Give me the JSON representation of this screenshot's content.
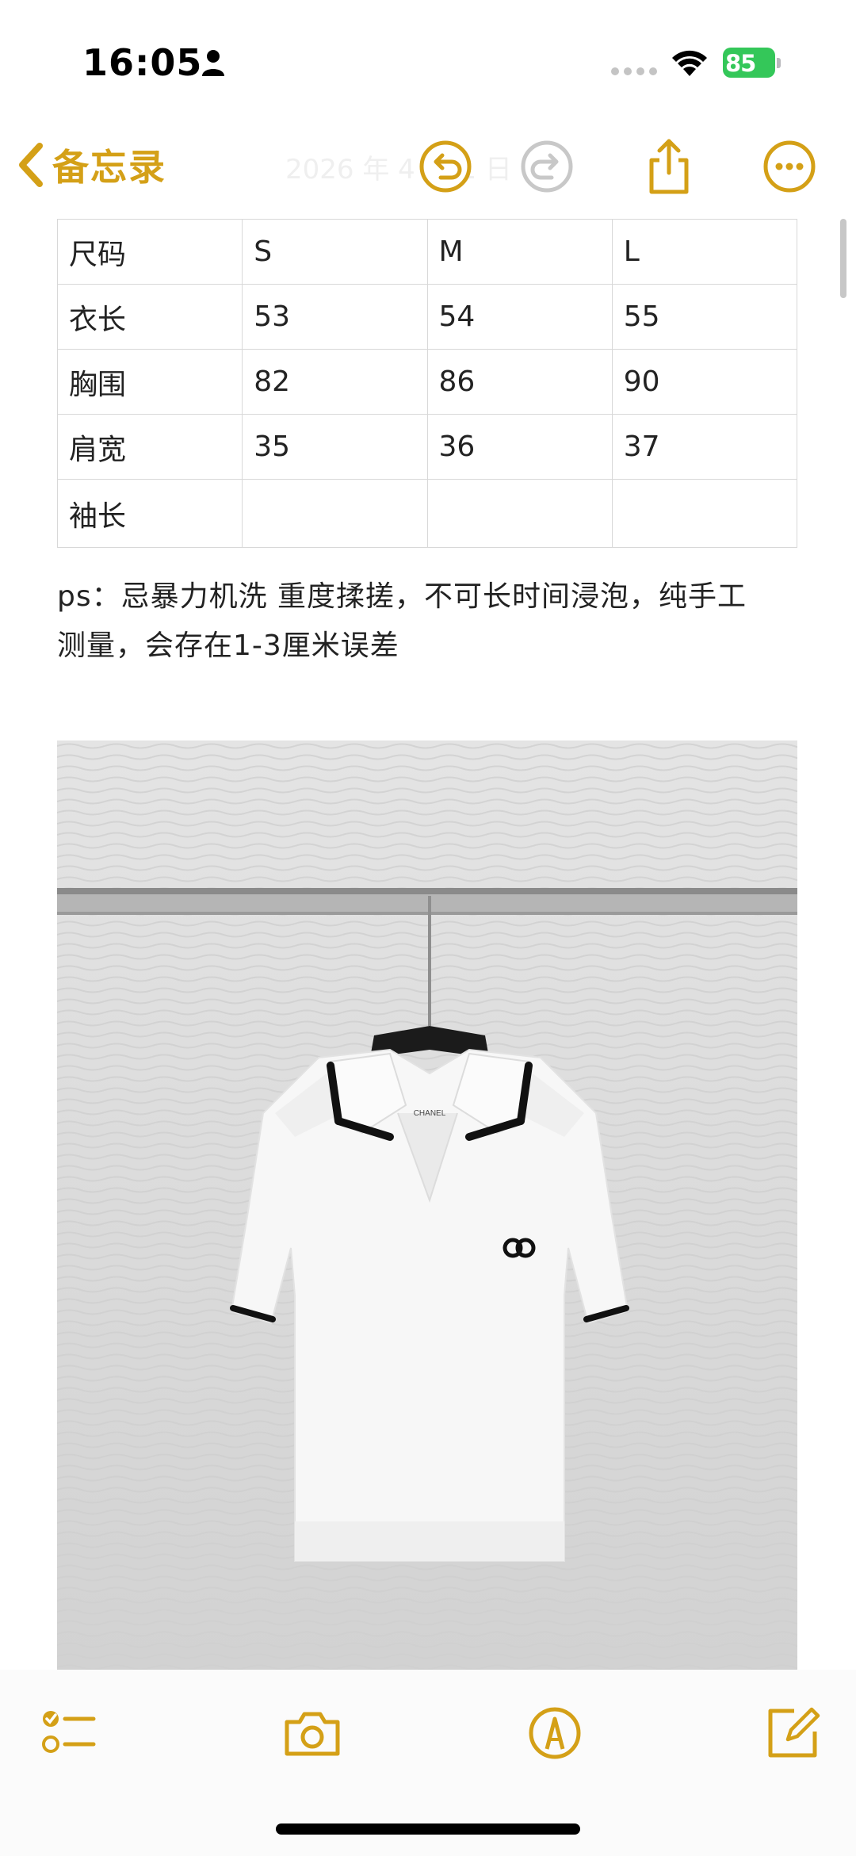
{
  "status_bar": {
    "time": "16:05",
    "battery": "85"
  },
  "nav": {
    "back_label": "备忘录",
    "ghost_title": "2026 年 4 月 1 日",
    "icons": [
      "chevron-left-icon",
      "undo-icon",
      "redo-icon",
      "share-icon",
      "more-icon"
    ]
  },
  "size_table": {
    "rows": [
      [
        "尺码",
        "S",
        "M",
        "L"
      ],
      [
        "衣长",
        "53",
        "54",
        "55"
      ],
      [
        "胸围",
        "82",
        "86",
        "90"
      ],
      [
        "肩宽",
        "35",
        "36",
        "37"
      ],
      [
        "袖长",
        "",
        "",
        ""
      ]
    ]
  },
  "note": {
    "line1": "ps：忌暴力机洗 重度揉搓，不可长时间浸泡，纯手工",
    "line2": "测量，会存在1-3厘米误差"
  },
  "photo": {
    "brand_label": "CHANEL"
  },
  "toolbar": {
    "icons": [
      "checklist-icon",
      "camera-icon",
      "markup-pen-icon",
      "compose-icon"
    ]
  },
  "colors": {
    "accent": "#d4a017",
    "battery": "#34c759"
  }
}
